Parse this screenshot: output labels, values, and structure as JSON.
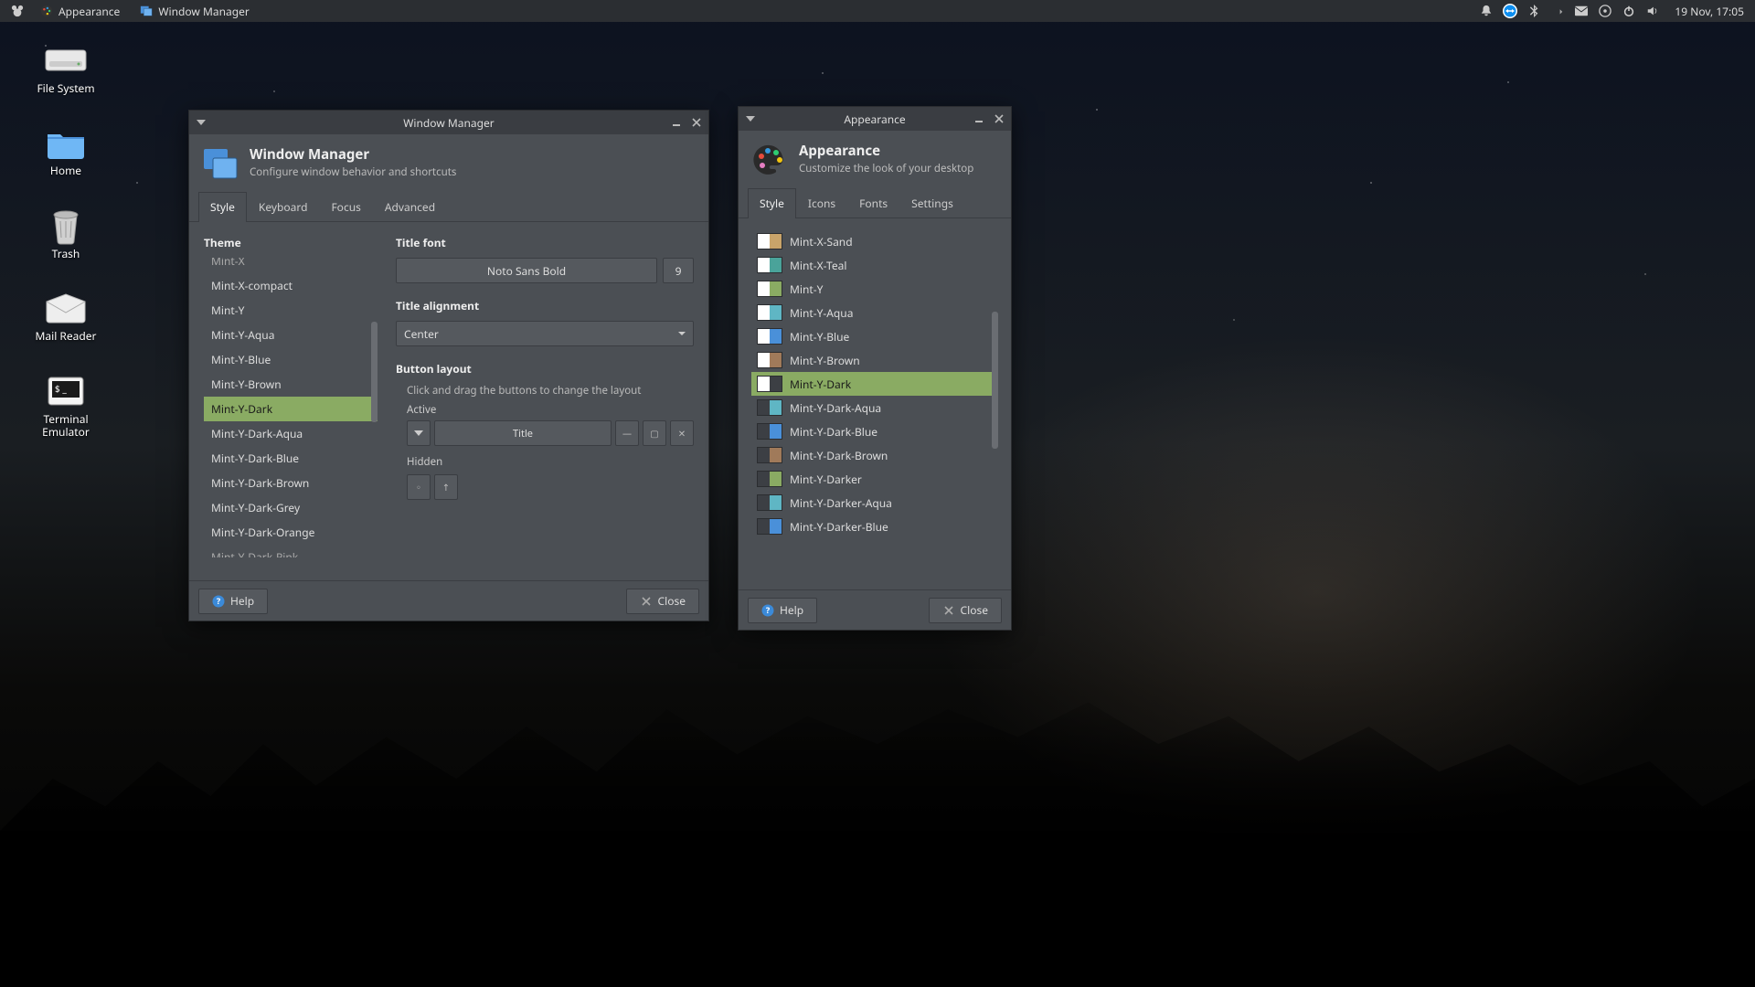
{
  "panel": {
    "tasks": [
      {
        "label": "Appearance"
      },
      {
        "label": "Window Manager"
      }
    ],
    "clock": "19 Nov, 17:05"
  },
  "desktop": {
    "icons": [
      {
        "id": "filesystem",
        "label": "File System"
      },
      {
        "id": "home",
        "label": "Home"
      },
      {
        "id": "trash",
        "label": "Trash"
      },
      {
        "id": "mail",
        "label": "Mail Reader"
      },
      {
        "id": "terminal",
        "label": "Terminal Emulator"
      }
    ]
  },
  "wm": {
    "titlebar": "Window Manager",
    "header_title": "Window Manager",
    "header_sub": "Configure window behavior and shortcuts",
    "tabs": [
      "Style",
      "Keyboard",
      "Focus",
      "Advanced"
    ],
    "active_tab": 0,
    "theme_label": "Theme",
    "themes": [
      "Mint-X",
      "Mint-X-compact",
      "Mint-Y",
      "Mint-Y-Aqua",
      "Mint-Y-Blue",
      "Mint-Y-Brown",
      "Mint-Y-Dark",
      "Mint-Y-Dark-Aqua",
      "Mint-Y-Dark-Blue",
      "Mint-Y-Dark-Brown",
      "Mint-Y-Dark-Grey",
      "Mint-Y-Dark-Orange",
      "Mint-Y-Dark-Pink"
    ],
    "theme_selected": "Mint-Y-Dark",
    "titlefont_label": "Title font",
    "titlefont_value": "Noto Sans Bold",
    "titlefont_size": "9",
    "titlealign_label": "Title alignment",
    "titlealign_value": "Center",
    "buttonlayout_label": "Button layout",
    "buttonlayout_hint": "Click and drag the buttons to change the layout",
    "active_label": "Active",
    "title_token": "Title",
    "hidden_label": "Hidden",
    "help": "Help",
    "close": "Close"
  },
  "ap": {
    "titlebar": "Appearance",
    "header_title": "Appearance",
    "header_sub": "Customize the look of your desktop",
    "tabs": [
      "Style",
      "Icons",
      "Fonts",
      "Settings"
    ],
    "active_tab": 0,
    "styles": [
      {
        "name": "Mint-X-Sand",
        "c1": "#ffffff",
        "c2": "#c9a46a"
      },
      {
        "name": "Mint-X-Teal",
        "c1": "#ffffff",
        "c2": "#4aa39a"
      },
      {
        "name": "Mint-Y",
        "c1": "#ffffff",
        "c2": "#8aab63"
      },
      {
        "name": "Mint-Y-Aqua",
        "c1": "#ffffff",
        "c2": "#5fb6c4"
      },
      {
        "name": "Mint-Y-Blue",
        "c1": "#ffffff",
        "c2": "#4a90d9"
      },
      {
        "name": "Mint-Y-Brown",
        "c1": "#ffffff",
        "c2": "#a07a5a"
      },
      {
        "name": "Mint-Y-Dark",
        "c1": "#ffffff",
        "c2": "#3c3f44"
      },
      {
        "name": "Mint-Y-Dark-Aqua",
        "c1": "#3c3f44",
        "c2": "#5fb6c4"
      },
      {
        "name": "Mint-Y-Dark-Blue",
        "c1": "#3c3f44",
        "c2": "#4a90d9"
      },
      {
        "name": "Mint-Y-Dark-Brown",
        "c1": "#3c3f44",
        "c2": "#a07a5a"
      },
      {
        "name": "Mint-Y-Darker",
        "c1": "#3c3f44",
        "c2": "#8aab63"
      },
      {
        "name": "Mint-Y-Darker-Aqua",
        "c1": "#3c3f44",
        "c2": "#5fb6c4"
      },
      {
        "name": "Mint-Y-Darker-Blue",
        "c1": "#3c3f44",
        "c2": "#4a90d9"
      }
    ],
    "style_selected": "Mint-Y-Dark",
    "help": "Help",
    "close": "Close"
  }
}
